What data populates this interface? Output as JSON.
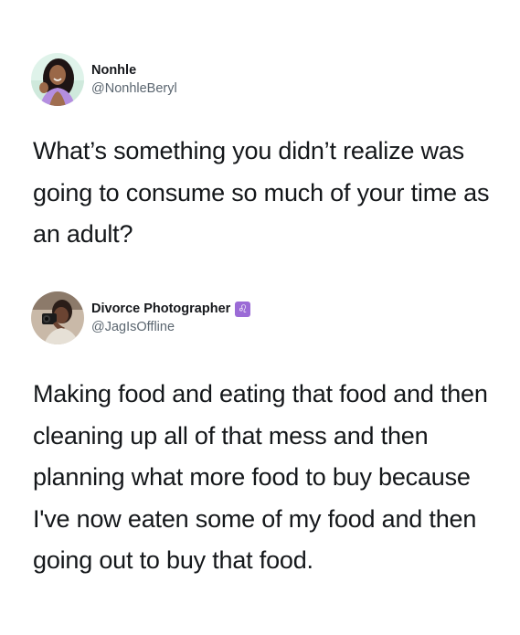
{
  "tweets": [
    {
      "display_name": "Nonhle",
      "handle": "@NonhleBeryl",
      "text": "What’s something you didn’t realize was going to consume so much of your time as an adult?"
    },
    {
      "display_name": "Divorce Photographer",
      "badge": "♌",
      "handle": "@JagIsOffline",
      "text": "Making food and eating that food and then cleaning up all of that mess and then planning what more food to buy because I've now eaten some of my food and then going out to buy that food."
    }
  ],
  "colors": {
    "text": "#14171a",
    "handle": "#5b6670",
    "badge": "#9b6bd6"
  }
}
